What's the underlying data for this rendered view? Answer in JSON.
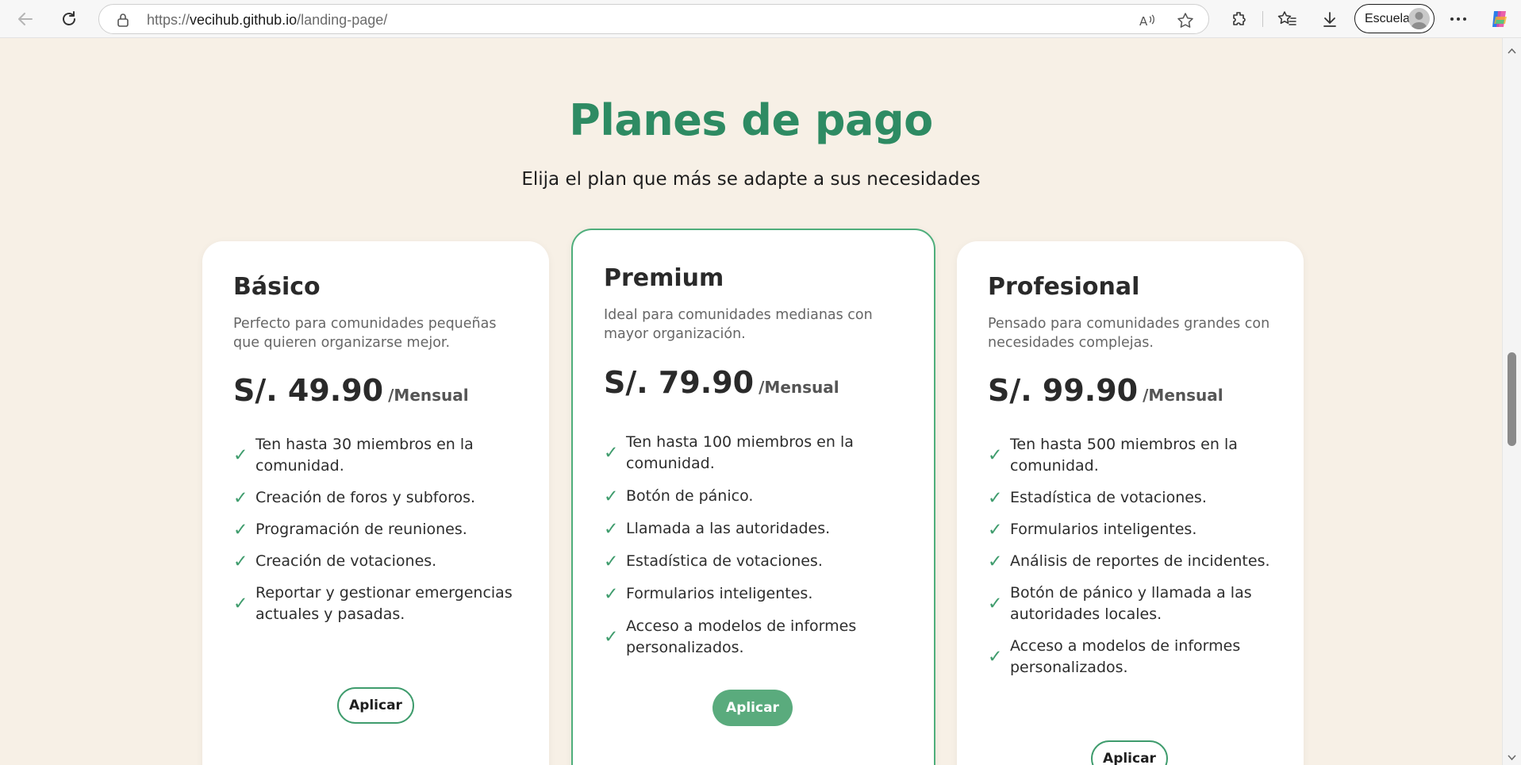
{
  "browser": {
    "url_scheme": "https://",
    "url_host": "vecihub.github.io",
    "url_path": "/landing-page/",
    "profile_label": "Escuela",
    "icons": [
      "back-icon",
      "refresh-icon",
      "lock-icon",
      "read-aloud-icon",
      "favorite-star-icon",
      "extensions-icon",
      "favorites-icon",
      "downloads-icon",
      "more-icon",
      "copilot-icon"
    ]
  },
  "pricing": {
    "title": "Planes de pago",
    "subtitle": "Elija el plan que más se adapte a sus necesidades",
    "check_symbol": "✓",
    "plans": [
      {
        "name": "Básico",
        "description": "Perfecto para comunidades pequeñas que quieren organizarse mejor.",
        "price": "S/. 49.90",
        "period": "/Mensual",
        "features": [
          "Ten hasta 30 miembros en la comunidad.",
          "Creación de foros y subforos.",
          "Programación de reuniones.",
          "Creación de votaciones.",
          "Reportar y gestionar emergencias actuales y pasadas."
        ],
        "button": "Aplicar"
      },
      {
        "name": "Premium",
        "description": "Ideal para comunidades medianas con mayor organización.",
        "price": "S/. 79.90",
        "period": "/Mensual",
        "features": [
          "Ten hasta 100 miembros en la comunidad.",
          "Botón de pánico.",
          "Llamada a las autoridades.",
          "Estadística de votaciones.",
          "Formularios inteligentes.",
          "Acceso a modelos de informes personalizados."
        ],
        "button": "Aplicar"
      },
      {
        "name": "Profesional",
        "description": "Pensado para comunidades grandes con necesidades complejas.",
        "price": "S/. 99.90",
        "period": "/Mensual",
        "features": [
          "Ten hasta 500 miembros en la comunidad.",
          "Estadística de votaciones.",
          "Formularios inteligentes.",
          "Análisis de reportes de incidentes.",
          "Botón de pánico y llamada a las autoridades locales.",
          "Acceso a modelos de informes personalizados."
        ],
        "button": "Aplicar"
      }
    ]
  },
  "colors": {
    "accent": "#2e8b63",
    "page_background": "#f7f0e6",
    "button_filled": "#5aab7d"
  }
}
